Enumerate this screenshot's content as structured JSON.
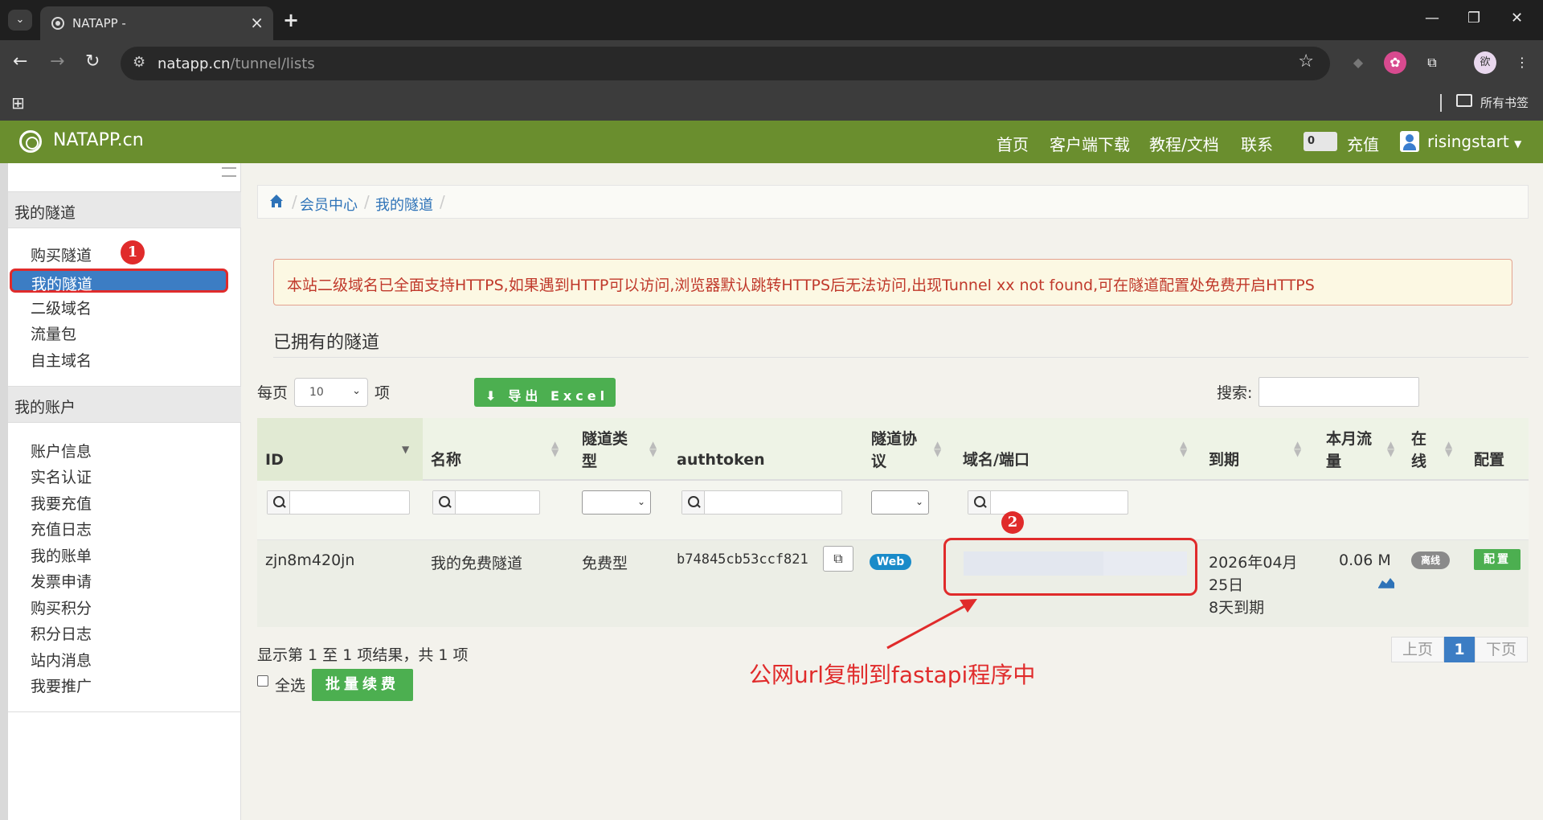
{
  "browser": {
    "tab_title": "NATAPP -",
    "url_host": "natapp.cn",
    "url_path": "/tunnel/lists",
    "bookmarks_all": "所有书签",
    "avatar_label": "欲"
  },
  "site": {
    "logo": "NATAPP.cn",
    "nav": [
      "首页",
      "客户端下载",
      "教程/文档",
      "联系"
    ],
    "balance": "0",
    "recharge": "充值",
    "username": "risingstart"
  },
  "sidebar": {
    "tunnels_header": "我的隧道",
    "tunnel_items": [
      "购买隧道",
      "我的隧道",
      "二级域名",
      "流量包",
      "自主域名"
    ],
    "account_header": "我的账户",
    "account_items": [
      "账户信息",
      "实名认证",
      "我要充值",
      "充值日志",
      "我的账单",
      "发票申请",
      "购买积分",
      "积分日志",
      "站内消息",
      "我要推广"
    ]
  },
  "breadcrumb": [
    "会员中心",
    "我的隧道"
  ],
  "alert": "本站二级域名已全面支持HTTPS,如果遇到HTTP可以访问,浏览器默认跳转HTTPS后无法访问,出现Tunnel xx not found,可在隧道配置处免费开启HTTPS",
  "section_title": "已拥有的隧道",
  "controls": {
    "per_page_label": "每页",
    "per_page_value": "10",
    "per_page_unit": "项",
    "export_label": "导出 Excel",
    "search_label": "搜索:"
  },
  "table": {
    "headers": {
      "id": "ID",
      "name": "名称",
      "type_l1": "隧道类",
      "type_l2": "型",
      "authtoken": "authtoken",
      "proto_l1": "隧道协",
      "proto_l2": "议",
      "domain": "域名/端口",
      "expire": "到期",
      "traffic_l1": "本月流",
      "traffic_l2": "量",
      "online_l1": "在",
      "online_l2": "线",
      "config": "配置"
    },
    "row": {
      "id": "zjn8m420jn",
      "name": "我的免费隧道",
      "type": "免费型",
      "authtoken": "b74845cb53ccf821",
      "protocol": "Web",
      "expire_l1": "2026年04月",
      "expire_l2": "25日",
      "expire_l3": "8天到期",
      "traffic": "0.06 M",
      "online": "离线",
      "config": "配置"
    }
  },
  "footer": {
    "info": "显示第 1 至 1 项结果，共 1 项",
    "prev": "上页",
    "current": "1",
    "next": "下页",
    "select_all": "全选",
    "batch_renew": "批量续费"
  },
  "annotations": {
    "badge1": "1",
    "badge2": "2",
    "note": "公网url复制到fastapi程序中"
  },
  "colors": {
    "site_nav": "#6a8e2e",
    "primary": "#3c7dc4",
    "success": "#4caf50",
    "annotation_red": "#e02b2b"
  }
}
